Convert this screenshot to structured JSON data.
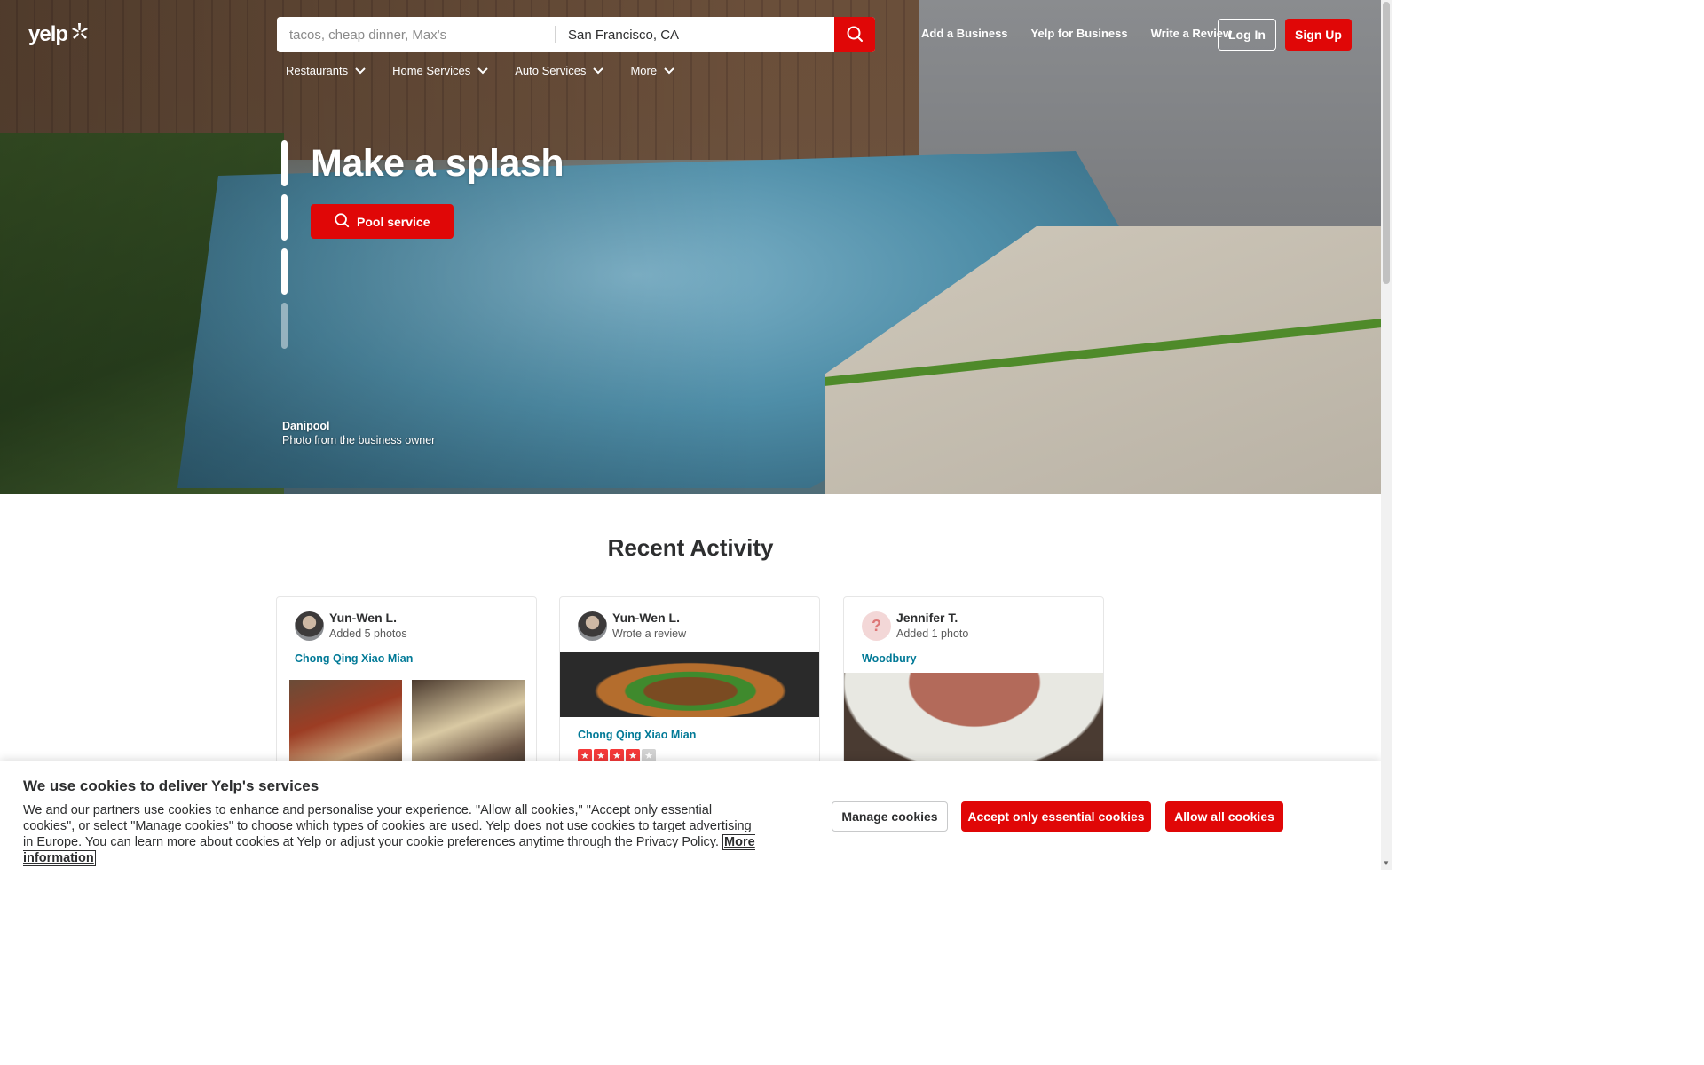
{
  "header": {
    "logo_text": "yelp",
    "search_find_placeholder": "tacos, cheap dinner, Max's",
    "search_near_value": "San Francisco, CA",
    "nav": [
      {
        "label": "Add a Business"
      },
      {
        "label": "Yelp for Business"
      },
      {
        "label": "Write a Review"
      }
    ],
    "login_label": "Log In",
    "signup_label": "Sign Up",
    "categories": [
      {
        "label": "Restaurants"
      },
      {
        "label": "Home Services"
      },
      {
        "label": "Auto Services"
      },
      {
        "label": "More"
      }
    ]
  },
  "hero": {
    "title": "Make a splash",
    "cta_label": "Pool service",
    "credit_business": "Danipool",
    "credit_note": "Photo from the business owner",
    "slides_active": [
      true,
      true,
      true,
      false
    ]
  },
  "recent_activity": {
    "title": "Recent Activity",
    "cards": [
      {
        "user": "Yun-Wen L.",
        "action": "Added 5 photos",
        "business": "Chong Qing Xiao Mian"
      },
      {
        "user": "Yun-Wen L.",
        "action": "Wrote a review",
        "business": "Chong Qing Xiao Mian",
        "rating": 4,
        "rating_max": 5
      },
      {
        "user": "Jennifer T.",
        "action": "Added 1 photo",
        "business": "Woodbury"
      }
    ]
  },
  "cookie_banner": {
    "title": "We use cookies to deliver Yelp's services",
    "body": "We and our partners use cookies to enhance and personalise your experience. \"Allow all cookies,\" \"Accept only essential cookies\", or select \"Manage cookies\" to choose which types of cookies are used. Yelp does not use cookies to target advertising in Europe. You can learn more about cookies at Yelp or adjust your cookie preferences anytime through the Privacy Policy.",
    "more_info_label": "More information",
    "manage_label": "Manage cookies",
    "essential_label": "Accept only essential cookies",
    "allow_label": "Allow all cookies"
  },
  "colors": {
    "brand_red": "#e00707",
    "link_teal": "#027a97",
    "text_dark": "#2d2e2f"
  },
  "icons": {
    "search": "search-icon",
    "chevron": "chevron-down-icon",
    "logo_burst": "yelp-burst-icon",
    "star": "star-icon"
  }
}
